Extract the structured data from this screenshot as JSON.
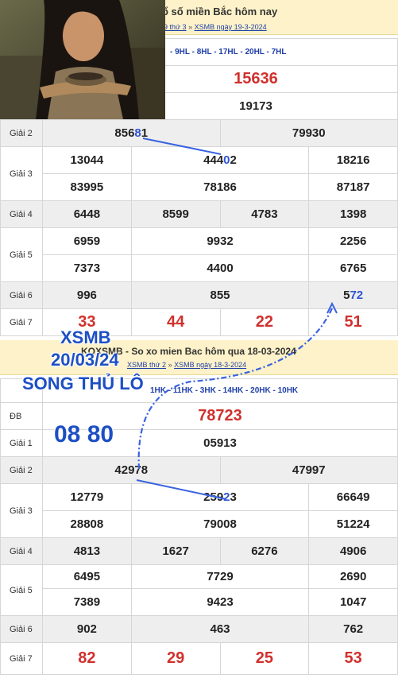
{
  "top": {
    "title": "ổ số miền Bắc hôm nay",
    "links": [
      "9 thứ 3",
      "XSMB ngày 19-3-2024"
    ],
    "codes": "- 9HL - 8HL - 17HL - 20HL - 7HL",
    "db": "15636",
    "g1": "19173",
    "rows": {
      "g2": {
        "label": "Giải 2",
        "a_pre": "856",
        "a_hl": "8",
        "a_post": "1",
        "b": "79930"
      },
      "g3": {
        "label": "Giải 3",
        "r1": [
          "13044",
          "18216"
        ],
        "r1b_pre": "444",
        "r1b_hl": "0",
        "r1b_post": "2",
        "r2": [
          "83995",
          "78186",
          "87187"
        ]
      },
      "g4": {
        "label": "Giải 4",
        "v": [
          "6448",
          "8599",
          "4783",
          "1398"
        ]
      },
      "g5": {
        "label": "Giải 5",
        "r1": [
          "6959",
          "9932",
          "2256"
        ],
        "r2": [
          "7373",
          "4400",
          "6765"
        ]
      },
      "g6": {
        "label": "Giải 6",
        "v": [
          "996",
          "855"
        ],
        "c_pre": "5",
        "c_hl": "72"
      },
      "g7": {
        "label": "Giải 7",
        "v": [
          "33",
          "44",
          "22",
          "51"
        ]
      }
    }
  },
  "bottom": {
    "title": "KQXSMB - So xo mien Bac hôm qua 18-03-2024",
    "links": [
      "XSMB thứ 2",
      "XSMB ngày 18-3-2024"
    ],
    "codes": "1HK - 11HK - 3HK - 14HK - 20HK - 10HK",
    "rows": {
      "db": {
        "label": "ĐB",
        "v": "78723"
      },
      "g1": {
        "label": "Giải 1",
        "v": "05913"
      },
      "g2": {
        "label": "Giải 2",
        "a": "42978",
        "b": "47997"
      },
      "g3": {
        "label": "Giải 3",
        "r1a": "12779",
        "r1b_pre": "259",
        "r1b_hl": "2",
        "r1b_post": "3",
        "r1c": "66649",
        "r2": [
          "28808",
          "79008",
          "51224"
        ]
      },
      "g4": {
        "label": "Giải 4",
        "v": [
          "4813",
          "1627",
          "6276",
          "4906"
        ]
      },
      "g5": {
        "label": "Giải 5",
        "r1": [
          "6495",
          "7729",
          "2690"
        ],
        "r2": [
          "7389",
          "9423",
          "1047"
        ]
      },
      "g6": {
        "label": "Giải 6",
        "v": [
          "902",
          "463",
          "762"
        ]
      },
      "g7": {
        "label": "Giải 7",
        "v": [
          "82",
          "29",
          "25",
          "53"
        ]
      }
    }
  },
  "overlay": {
    "line1": "XSMB",
    "line2": "20/03/24",
    "line3": "SONG THỦ LÔ",
    "pair": "08 80"
  },
  "colors": {
    "header_bg": "#fdf2c9",
    "red": "#d0312d",
    "blue": "#2f55d4",
    "link": "#1f3fa8"
  }
}
